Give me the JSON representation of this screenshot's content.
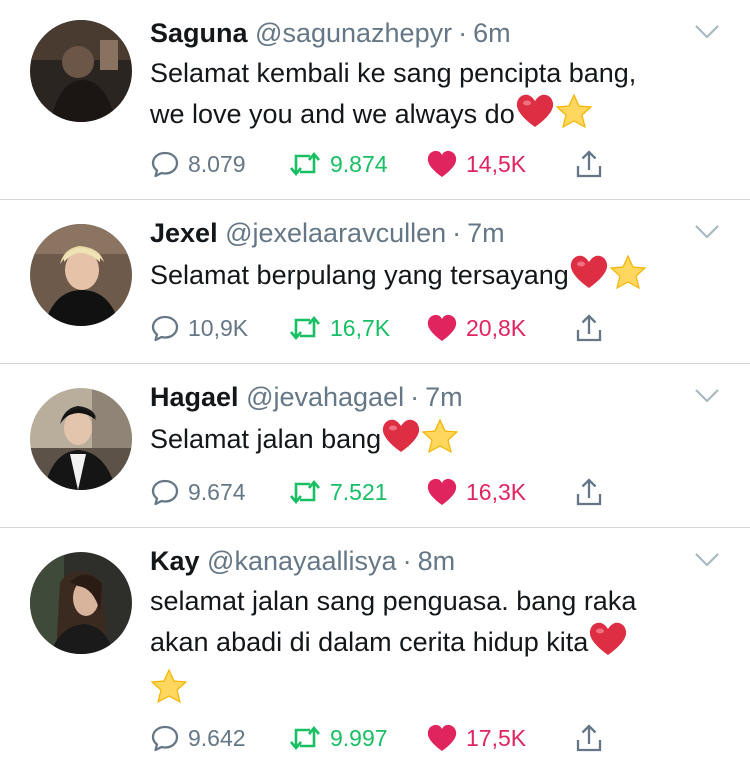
{
  "tweets": [
    {
      "name": "Saguna",
      "handle": "@sagunazhepyr",
      "separator": "·",
      "time": "6m",
      "text_lines": [
        "Selamat kembali ke sang pencipta bang,",
        "we love you and we always do"
      ],
      "emojis": [
        "heart",
        "star"
      ],
      "replies": "8.079",
      "retweets": "9.874",
      "likes": "14,5K"
    },
    {
      "name": "Jexel",
      "handle": "@jexelaaravcullen",
      "separator": "·",
      "time": "7m",
      "text_lines": [
        "Selamat berpulang yang tersayang"
      ],
      "emojis": [
        "heart",
        "star"
      ],
      "replies": "10,9K",
      "retweets": "16,7K",
      "likes": "20,8K"
    },
    {
      "name": "Hagael",
      "handle": "@jevahagael",
      "separator": "·",
      "time": "7m",
      "text_lines": [
        "Selamat jalan bang"
      ],
      "emojis": [
        "heart",
        "star"
      ],
      "replies": "9.674",
      "retweets": "7.521",
      "likes": "16,3K"
    },
    {
      "name": "Kay",
      "handle": "@kanayaallisya",
      "separator": "·",
      "time": "8m",
      "text_lines": [
        "selamat jalan sang penguasa. bang raka",
        "akan abadi di dalam cerita hidup kita"
      ],
      "emojis": [
        "heart",
        "star"
      ],
      "replies": "9.642",
      "retweets": "9.997",
      "likes": "17,5K"
    }
  ],
  "icons": {
    "reply": "reply-bubble-icon",
    "retweet": "retweet-arrows-icon",
    "like": "heart-icon",
    "share": "share-upload-icon",
    "menu": "chevron-down-icon"
  },
  "colors": {
    "text": "#14171a",
    "secondary": "#657786",
    "retweet": "#17bf63",
    "like": "#e0245e",
    "divider": "#d3d6da"
  }
}
